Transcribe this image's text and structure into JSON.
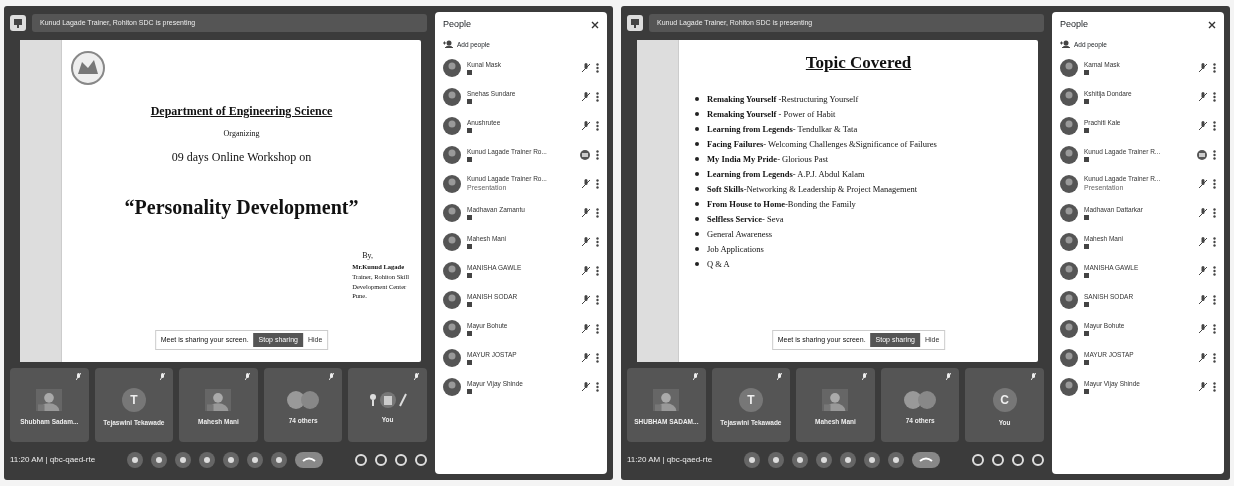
{
  "screens": [
    {
      "presenter_bar": "Kunud Lagade Trainer, Rohiton SDC is presenting",
      "slide": {
        "kind": "title",
        "heading": "Department of Engineering Science",
        "lines": [
          "Organizing",
          "09 days  Online Workshop on"
        ],
        "title": "“Personality Development”",
        "by": "By,",
        "credits": [
          "Mr.Kunud  Lagade",
          "Trainer, Rohiton Skill",
          "Development Center",
          "Pune."
        ]
      },
      "share_notice": {
        "text": "Meet is sharing your screen.",
        "stop": "Stop sharing",
        "hide": "Hide"
      },
      "tiles": [
        {
          "kind": "picture",
          "name": "Shubham Sadam..."
        },
        {
          "kind": "letter",
          "letter": "T",
          "name": "Tejaswini Tekawade"
        },
        {
          "kind": "picture",
          "name": "Mahesh Mani"
        },
        {
          "kind": "group",
          "name": "74 others"
        },
        {
          "kind": "self",
          "name": "You"
        }
      ],
      "meeting": "11:20 AM | qbc-qaed-rte",
      "people": {
        "title": "People",
        "add": "Add people",
        "list": [
          {
            "name": "Kunal Mask",
            "kind": "muted"
          },
          {
            "name": "Snehas Sundare",
            "kind": "muted"
          },
          {
            "name": "Anushrutee",
            "kind": "muted"
          },
          {
            "name": "Kunud Lagade Trainer Ro...",
            "kind": "presenting"
          },
          {
            "name": "Kunud Lagade Trainer Ro...",
            "subtitle": "Presentation",
            "kind": "muted"
          },
          {
            "name": "Madhavan Zamantu",
            "kind": "muted"
          },
          {
            "name": "Mahesh Mani",
            "kind": "muted"
          },
          {
            "name": "MANISHA GAWLE",
            "kind": "muted"
          },
          {
            "name": "MANISH SODAR",
            "kind": "muted"
          },
          {
            "name": "Mayur Bohute",
            "kind": "muted"
          },
          {
            "name": "MAYUR JOSTAP",
            "kind": "muted"
          },
          {
            "name": "Mayur Vijay Shinde",
            "kind": "muted"
          }
        ]
      }
    },
    {
      "presenter_bar": "Kunud Lagade Trainer, Rohiton SDC is presenting",
      "slide": {
        "kind": "list",
        "heading": "Topic Covered",
        "items": [
          "**Remaking Yourself** -Restructuring Yourself",
          "**Remaking Yourself** - Power of Habit",
          "**Learning from Legends**- Tendulkar & Tata",
          "**Facing Failures**- Welcoming Challenges &Significance of Failures",
          "**My India My Pride**- Glorious Past",
          "**Learning from Legends**- A.P.J. Abdul Kalam",
          "**Soft Skills**-Networking & Leadership & Project Management",
          "**From House to Home**-Bonding the Family",
          "**Selfless Service**- Seva",
          "General Awareness",
          "Job Applications",
          "Q & A"
        ]
      },
      "share_notice": {
        "text": "Meet is sharing your screen.",
        "stop": "Stop sharing",
        "hide": "Hide"
      },
      "tiles": [
        {
          "kind": "picture",
          "name": "SHUBHAM SADAM..."
        },
        {
          "kind": "letter",
          "letter": "T",
          "name": "Tejaswini Tekawade"
        },
        {
          "kind": "picture",
          "name": "Mahesh Mani"
        },
        {
          "kind": "group",
          "name": "74 others"
        },
        {
          "kind": "letter",
          "letter": "C",
          "name": "You"
        }
      ],
      "meeting": "11:20 AM | qbc-qaed-rte",
      "people": {
        "title": "People",
        "add": "Add people",
        "list": [
          {
            "name": "Kamal Mask",
            "kind": "muted"
          },
          {
            "name": "Kshitija Dondare",
            "kind": "muted"
          },
          {
            "name": "Prachiti Kale",
            "kind": "muted"
          },
          {
            "name": "Kunud Lagade Trainer R...",
            "kind": "presenting"
          },
          {
            "name": "Kunud Lagade Trainer R...",
            "subtitle": "Presentation",
            "kind": "muted"
          },
          {
            "name": "Madhavan Dattarkar",
            "kind": "muted"
          },
          {
            "name": "Mahesh Mani",
            "kind": "muted"
          },
          {
            "name": "MANISHA GAWLE",
            "kind": "muted"
          },
          {
            "name": "SANISH SODAR",
            "kind": "muted"
          },
          {
            "name": "Mayur Bohute",
            "kind": "muted"
          },
          {
            "name": "MAYUR JOSTAP",
            "kind": "muted"
          },
          {
            "name": "Mayur Vijay Shinde",
            "kind": "muted"
          }
        ]
      }
    }
  ]
}
